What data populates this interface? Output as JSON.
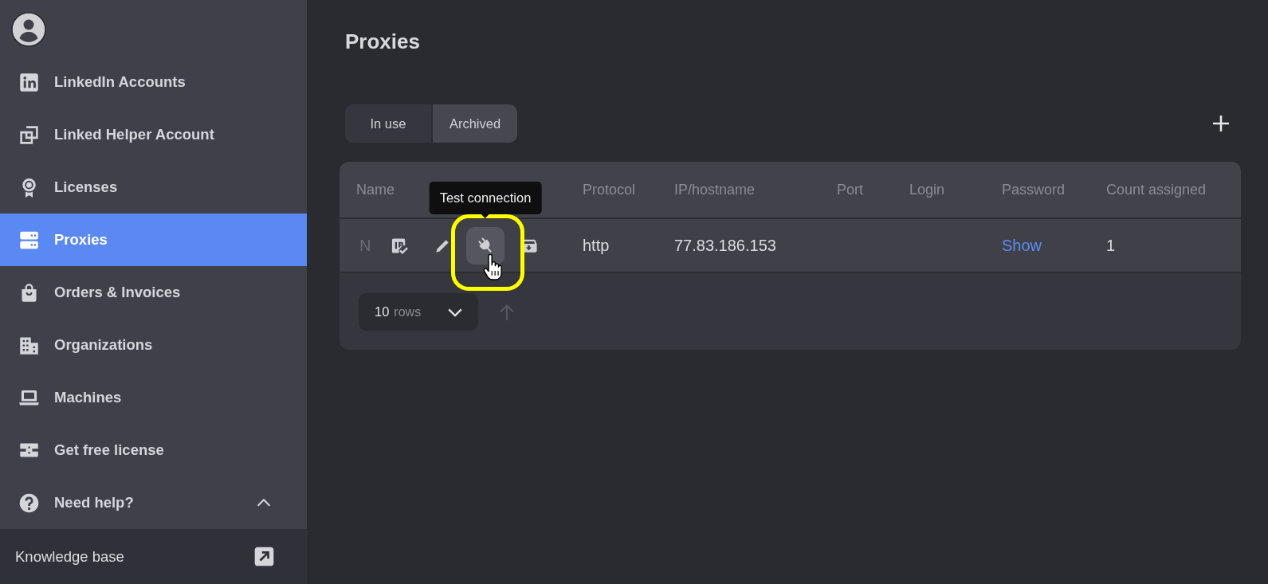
{
  "sidebar": {
    "items": [
      {
        "label": "LinkedIn Accounts",
        "selected": false
      },
      {
        "label": "Linked Helper Account",
        "selected": false
      },
      {
        "label": "Licenses",
        "selected": false
      },
      {
        "label": "Proxies",
        "selected": true
      },
      {
        "label": "Orders & Invoices",
        "selected": false
      },
      {
        "label": "Organizations",
        "selected": false
      },
      {
        "label": "Machines",
        "selected": false
      },
      {
        "label": "Get free license",
        "selected": false
      }
    ],
    "help": {
      "label": "Need help?",
      "expanded": true,
      "links": [
        {
          "label": "Knowledge base"
        }
      ]
    }
  },
  "page": {
    "title": "Proxies"
  },
  "tabs": [
    {
      "label": "In use",
      "selected": false
    },
    {
      "label": "Archived",
      "selected": true
    }
  ],
  "table": {
    "columns": [
      "Name",
      "Protocol",
      "IP/hostname",
      "Port",
      "Login",
      "Password",
      "Count assigned"
    ],
    "rows": [
      {
        "name": "N",
        "actions": [
          {
            "hovered": false
          },
          {
            "hovered": false
          },
          {
            "hovered": true,
            "annotated": true,
            "tooltip": "Test connection"
          },
          {
            "hovered": false
          }
        ],
        "protocol": "http",
        "ip_hostname": "77.83.186.153",
        "password": "Show",
        "count_assigned": "1"
      }
    ],
    "footer": {
      "page_size": "10",
      "page_size_unit": "rows",
      "back_to_top": {
        "disabled": true
      }
    }
  }
}
